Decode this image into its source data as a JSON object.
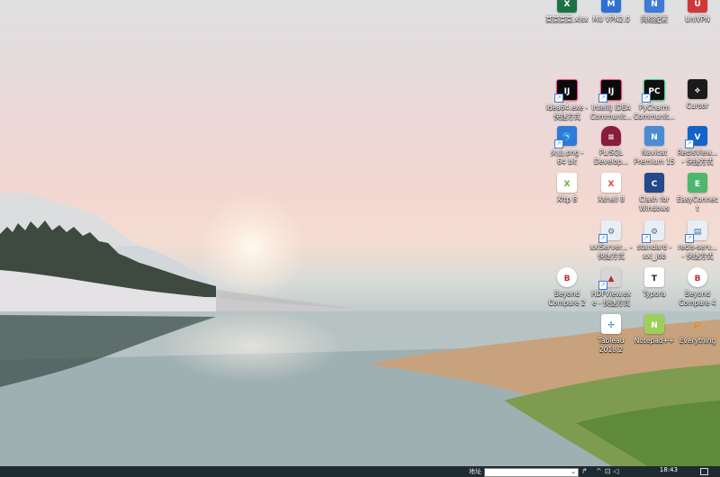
{
  "desktop": {
    "icons": [
      {
        "label": "某某某某.xlsx",
        "color": "#1e7145",
        "glyph": "X"
      },
      {
        "label": "MU VPN2.0",
        "color": "#2e6fd4",
        "glyph": "M"
      },
      {
        "label": "网络配置",
        "color": "#3f7ad6",
        "glyph": "N"
      },
      {
        "label": "UniVPN",
        "color": "#d0363a",
        "glyph": "U"
      },
      {
        "label": "idea64.exe - 快捷方式",
        "color": "#0a0a0a",
        "glyph": "IJ"
      },
      {
        "label": "IntelliJ IDEA Communit...",
        "color": "#0a0a0a",
        "glyph": "IJ"
      },
      {
        "label": "PyCharm Communit...",
        "color": "#101010",
        "glyph": "PC"
      },
      {
        "label": "Cursor",
        "color": "#1b1b1b",
        "glyph": "⟡"
      },
      {
        "label": "火山.png - 64 bit",
        "color": "#2f79d9",
        "glyph": "🐬"
      },
      {
        "label": "PL/SQL Develop...",
        "color": "#8a1b3a",
        "glyph": "≡"
      },
      {
        "label": "Navicat Premium 15",
        "color": "#4a8bd4",
        "glyph": "N"
      },
      {
        "label": "RedisView... - 快捷方式",
        "color": "#1363c9",
        "glyph": "V"
      },
      {
        "label": "Xftp 8",
        "color": "#61b246",
        "glyph": "X"
      },
      {
        "label": "Xshell 8",
        "color": "#e9413b",
        "glyph": "X"
      },
      {
        "label": "Clash for Windows",
        "color": "#234a8a",
        "glyph": "C"
      },
      {
        "label": "EasyConnect",
        "color": "#4db86d",
        "glyph": "E"
      },
      {
        "label": "xxlServer... - 快捷方式",
        "color": "#e8eef5",
        "glyph": "⚙"
      },
      {
        "label": "standard - xxl_job",
        "color": "#e8eef5",
        "glyph": "⚙"
      },
      {
        "label": "redis-serv... - 快捷方式",
        "color": "#e8eef5",
        "glyph": "▤"
      },
      {
        "label": "Beyond Compare 2",
        "color": "#c02d2d",
        "glyph": "B"
      },
      {
        "label": "HDFView.exe - 快捷方式",
        "color": "#d5d5d5",
        "glyph": "▲"
      },
      {
        "label": "Typora",
        "color": "#ffffff",
        "glyph": "T"
      },
      {
        "label": "Beyond Compare 4",
        "color": "#c02d2d",
        "glyph": "B"
      },
      {
        "label": "Tableau 2018.2",
        "color": "#ffffff",
        "glyph": "✢"
      },
      {
        "label": "Notepad++",
        "color": "#9ccf5c",
        "glyph": "N"
      },
      {
        "label": "Everything",
        "color": "#e58a25",
        "glyph": "⌕"
      }
    ]
  },
  "taskbar": {
    "address_label": "地址",
    "address_value": "",
    "time": "18:43"
  }
}
